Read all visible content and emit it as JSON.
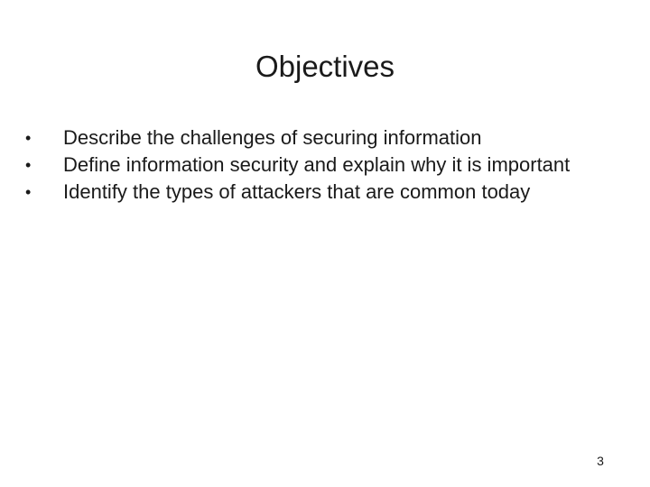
{
  "slide": {
    "title": "Objectives",
    "bullets": [
      {
        "marker": "•",
        "text": "Describe the challenges of securing information"
      },
      {
        "marker": "•",
        "text": "Define information security and explain why it is important"
      },
      {
        "marker": "•",
        "text": "Identify the types of attackers that are common today"
      }
    ],
    "page_number": "3"
  }
}
